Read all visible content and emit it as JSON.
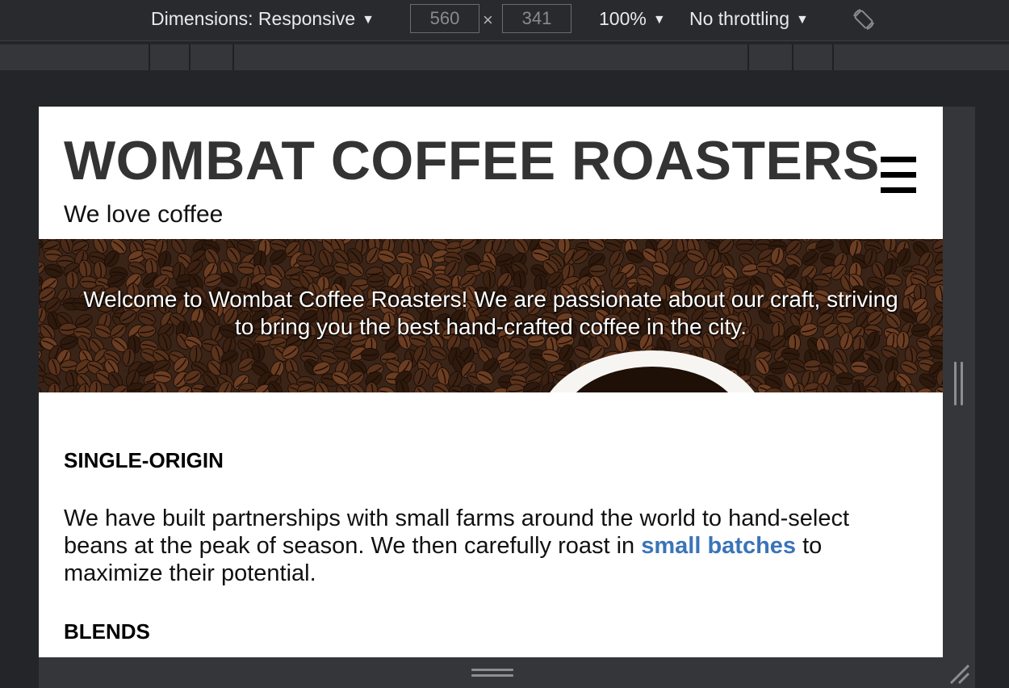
{
  "devtools": {
    "dimensions_label": "Dimensions: Responsive",
    "width_value": "560",
    "height_value": "341",
    "times_symbol": "×",
    "zoom_label": "100%",
    "throttling_label": "No throttling",
    "caret": "▼",
    "rotate_icon": "rotate-icon"
  },
  "site": {
    "title": "WOMBAT COFFEE ROASTERS",
    "tagline": "We love coffee",
    "menu_icon": "hamburger-menu-icon",
    "hero_text": "Welcome to Wombat Coffee Roasters! We are passionate about our craft, striving to bring you the best hand-crafted coffee in the city.",
    "sections": [
      {
        "heading": "SINGLE-ORIGIN",
        "body_before": "We have built partnerships with small farms around the world to hand-select beans at the peak of season. We then carefully roast in ",
        "link_text": "small batches",
        "body_after": " to maximize their potential."
      },
      {
        "heading": "BLENDS"
      }
    ]
  },
  "colors": {
    "link": "#3a74b8",
    "title": "#333333",
    "devtools_bg": "#242528"
  }
}
